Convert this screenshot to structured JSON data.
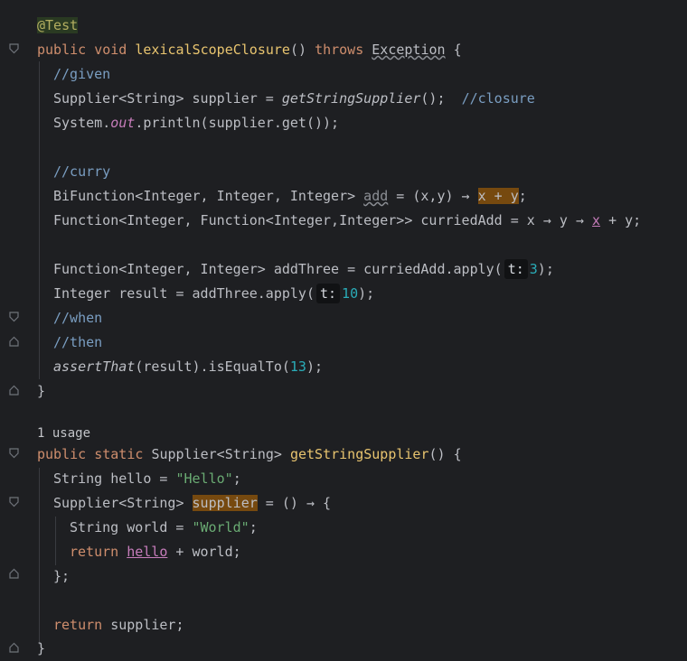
{
  "colors": {
    "background": "#1e1f22",
    "keyword": "#cf8e6d",
    "annotation": "#b3ae60",
    "method_decl": "#e8c46f",
    "comment": "#7a9ec2",
    "string": "#6aab73",
    "number": "#2aacb8",
    "highlight": "#76490f"
  },
  "icons": {
    "fold": "fold-marker-icon"
  },
  "code": {
    "annotation": "@Test",
    "kw_public": "public",
    "kw_void": "void",
    "method1": "lexicalScopeClosure",
    "method1_parens": "()",
    "kw_throws": "throws",
    "exception": "Exception",
    "open_brace": "{",
    "close_brace": "}",
    "comment_given": "//given",
    "supplier_decl": "Supplier<String> supplier = ",
    "get_string_supplier_call": "getStringSupplier",
    "call_tail": "();",
    "comment_closure": "//closure",
    "system": "System",
    "dot": ".",
    "out": "out",
    "println": ".println(supplier.get());",
    "comment_curry": "//curry",
    "bifunction_decl": "BiFunction<Integer, Integer, Integer> ",
    "add_var": "add",
    "lambda_xy": " = (x,y) → ",
    "x_plus_y": "x + y",
    "semicolon": ";",
    "function_decl": "Function<Integer, Function<Integer,Integer>> curriedAdd = x → y → ",
    "x_var": "x",
    "plus_y": " + y;",
    "addthree_decl": "Function<Integer, Integer> addThree = curriedAdd.apply(",
    "hint_t": "t:",
    "num_3": "3",
    "close_paren_semi": ");",
    "result_decl": "Integer result = addThree.apply(",
    "num_10": "10",
    "comment_when": "//when",
    "comment_then": "//then",
    "assert_that": "assertThat",
    "assert_tail": "(result).isEqualTo(",
    "num_13": "13",
    "usage_hint": "1 usage",
    "kw_static": "static",
    "supplier_type": "Supplier<String>",
    "method2": "getStringSupplier",
    "method2_parens": "() {",
    "hello_decl": "String hello = ",
    "hello_str": "\"Hello\"",
    "supplier_type2": "Supplier<String> ",
    "supplier_var": "supplier",
    "lambda_open": " = () → {",
    "world_decl": "String world = ",
    "world_str": "\"World\"",
    "kw_return": "return",
    "hello_var": "hello",
    "plus_world": " + world;",
    "lambda_close": "};",
    "return_supplier": " supplier;"
  }
}
